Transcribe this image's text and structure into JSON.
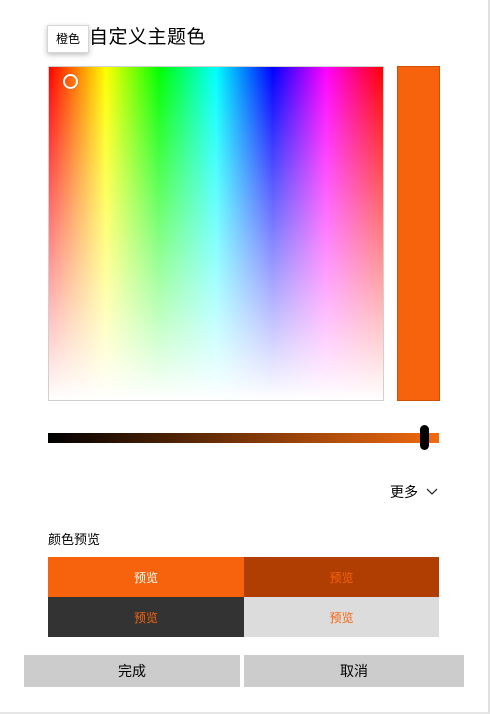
{
  "dialog": {
    "title": "自定义主题色",
    "tooltip": "橙色"
  },
  "color": {
    "selected": "#f7630c",
    "accent_dark": "#b03d02",
    "dark_bg": "#333333",
    "light_bg": "#dcdcdc"
  },
  "more": {
    "label": "更多"
  },
  "preview": {
    "section_label": "颜色预览",
    "tiles": [
      {
        "label": "预览",
        "bg": "#f7630c",
        "fg": "#ffffff"
      },
      {
        "label": "预览",
        "bg": "#b03d02",
        "fg": "#f7630c"
      },
      {
        "label": "预览",
        "bg": "#333333",
        "fg": "#f7630c"
      },
      {
        "label": "预览",
        "bg": "#dcdcdc",
        "fg": "#f7630c"
      }
    ]
  },
  "buttons": {
    "done": "完成",
    "cancel": "取消"
  }
}
